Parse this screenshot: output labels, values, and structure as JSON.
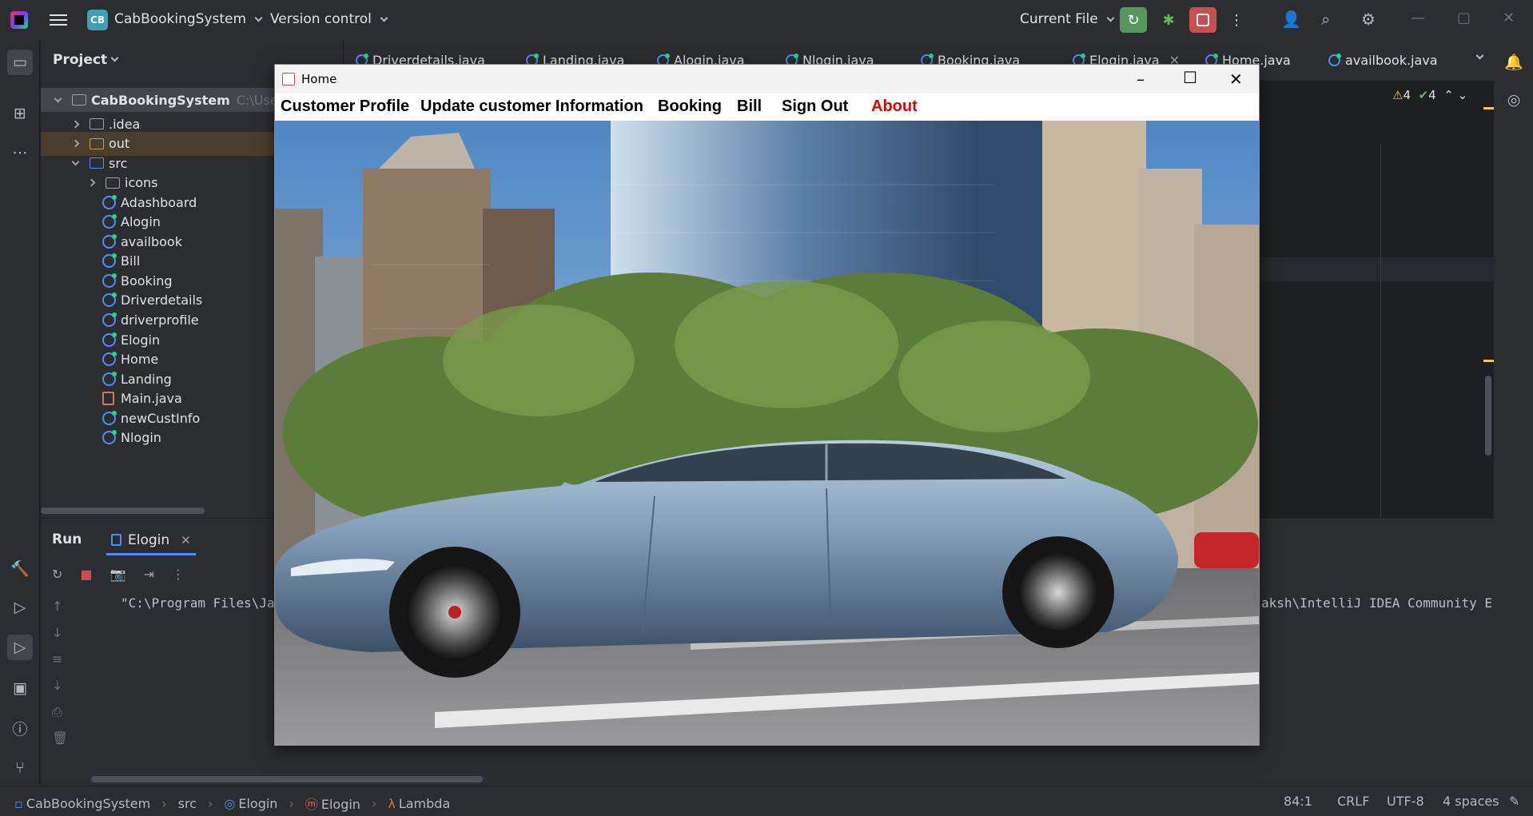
{
  "titlebar": {
    "logo_badge": "CB",
    "project_name": "CabBookingSystem",
    "vcs_label": "Version control",
    "run_config": "Current File"
  },
  "project_panel": {
    "title": "Project",
    "root": {
      "label": "CabBookingSystem",
      "path_hint": "C:\\Use"
    },
    "items": [
      {
        "label": ".idea",
        "type": "folder"
      },
      {
        "label": "out",
        "type": "folder-excluded"
      },
      {
        "label": "src",
        "type": "folder-source"
      },
      {
        "label": "icons",
        "type": "package"
      },
      {
        "label": "Adashboard",
        "type": "class"
      },
      {
        "label": "Alogin",
        "type": "class"
      },
      {
        "label": "availbook",
        "type": "class"
      },
      {
        "label": "Bill",
        "type": "class"
      },
      {
        "label": "Booking",
        "type": "class"
      },
      {
        "label": "Driverdetails",
        "type": "class"
      },
      {
        "label": "driverprofile",
        "type": "class"
      },
      {
        "label": "Elogin",
        "type": "class"
      },
      {
        "label": "Home",
        "type": "class"
      },
      {
        "label": "Landing",
        "type": "class"
      },
      {
        "label": "Main.java",
        "type": "java"
      },
      {
        "label": "newCustInfo",
        "type": "class"
      },
      {
        "label": "Nlogin",
        "type": "class"
      }
    ]
  },
  "editor": {
    "tabs": [
      "Driverdetails.java",
      "Landing.java",
      "Alogin.java",
      "Nlogin.java",
      "Booking.java",
      "Elogin.java",
      "Home.java",
      "availbook.java"
    ],
    "warnings": "4",
    "checks": "4"
  },
  "run_panel": {
    "title": "Run",
    "tab_label": "Elogin",
    "console_left": "\"C:\\Program Files\\Java\\",
    "console_right": "aksh\\IntelliJ IDEA Community E"
  },
  "statusbar": {
    "crumbs": [
      "CabBookingSystem",
      "src",
      "Elogin",
      "Elogin",
      "Lambda"
    ],
    "position": "84:1",
    "line_sep": "CRLF",
    "encoding": "UTF-8",
    "indent": "4 spaces"
  },
  "swing_window": {
    "title": "Home",
    "menu": [
      "Customer Profile",
      "Update customer Information",
      "Booking",
      "Bill",
      "Sign Out",
      "About"
    ]
  },
  "colors": {
    "accent_blue": "#548af7",
    "run_green": "#57965c",
    "stop_red": "#c94f4f",
    "about_red": "#e00000"
  }
}
